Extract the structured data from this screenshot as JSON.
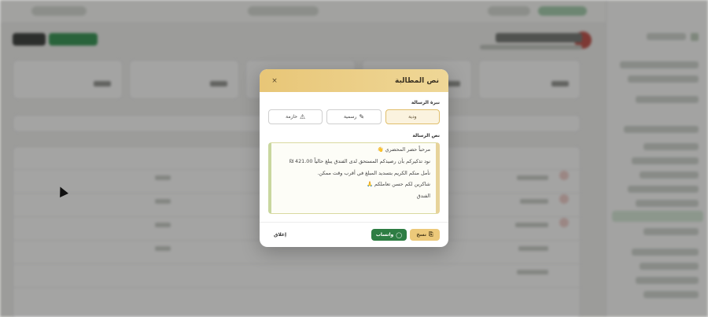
{
  "modal": {
    "title": "نص المطالبة",
    "close_icon": "×",
    "tone_label": "نبرة الرسالة",
    "tones": [
      {
        "label": "ودية",
        "icon": "",
        "active": true
      },
      {
        "label": "رسمية",
        "icon": "✎",
        "active": false
      },
      {
        "label": "حازمة",
        "icon": "⚠",
        "active": false
      }
    ],
    "message_label": "نص الرسالة",
    "message_lines": [
      "مرحباً حضر المحضري 👋",
      "نود تذكيركم بأن رصيدكم المستحق لدى الفندق يبلغ حالياً 421.00 ₪",
      "نأمل منكم الكريم بتسديد المبلغ في أقرب وقت ممكن.",
      "شاكرين لكم حسن تعاملكم 🙏",
      "الفندق"
    ],
    "buttons": {
      "copy": "نسخ",
      "copy_icon": "⎘",
      "whatsapp": "واتساب",
      "whatsapp_icon": "◯",
      "close": "إغلاق"
    }
  },
  "colors": {
    "header_gradient_start": "#e8c677",
    "whatsapp_green": "#2e7d43",
    "copy_gold": "#ecc97a"
  }
}
